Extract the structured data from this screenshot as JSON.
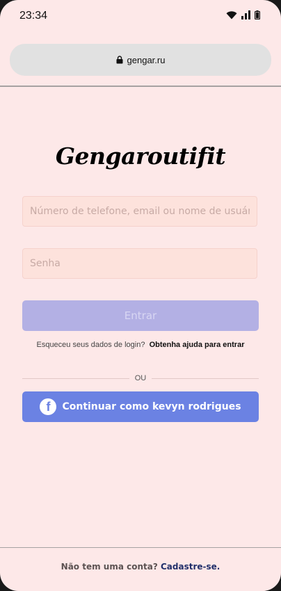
{
  "status_bar": {
    "time": "23:34"
  },
  "browser": {
    "url": "gengar.ru"
  },
  "login": {
    "logo": "Gengaroutifit",
    "identifier_placeholder": "Número de telefone, email ou nome de usuário.",
    "password_placeholder": "Senha",
    "login_button": "Entrar",
    "forgot_text": "Esqueceu seus dados de login?",
    "help_link": "Obtenha ajuda para entrar",
    "or_text": "OU",
    "facebook_button": "Continuar como kevyn rodrigues",
    "facebook_icon_glyph": "f"
  },
  "footer": {
    "no_account_text": "Não tem uma conta?",
    "signup_link": "Cadastre-se."
  },
  "colors": {
    "background": "#fde8e8",
    "login_button_disabled": "#b3b0e4",
    "facebook_button": "#6b82e3",
    "signup_link": "#22306b"
  }
}
